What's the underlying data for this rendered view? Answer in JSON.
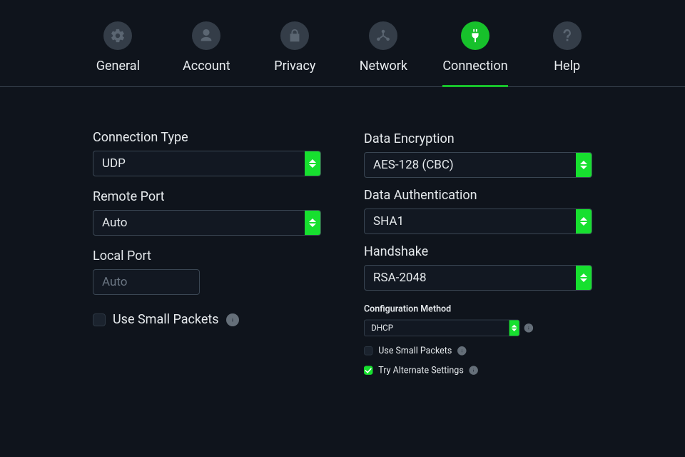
{
  "tabs": {
    "general": {
      "label": "General"
    },
    "account": {
      "label": "Account"
    },
    "privacy": {
      "label": "Privacy"
    },
    "network": {
      "label": "Network"
    },
    "connection": {
      "label": "Connection"
    },
    "help": {
      "label": "Help"
    }
  },
  "left": {
    "connection_type": {
      "label": "Connection Type",
      "value": "UDP"
    },
    "remote_port": {
      "label": "Remote Port",
      "value": "Auto"
    },
    "local_port": {
      "label": "Local Port",
      "placeholder": "Auto"
    },
    "use_small_packets": {
      "label": "Use Small Packets",
      "checked": false
    }
  },
  "right": {
    "data_encryption": {
      "label": "Data Encryption",
      "value": "AES-128 (CBC)"
    },
    "data_authentication": {
      "label": "Data Authentication",
      "value": "SHA1"
    },
    "handshake": {
      "label": "Handshake",
      "value": "RSA-2048"
    },
    "config": {
      "heading": "Configuration Method",
      "value": "DHCP",
      "use_small_packets": {
        "label": "Use Small Packets",
        "checked": false
      },
      "try_alternate_settings": {
        "label": "Try Alternate Settings",
        "checked": true
      }
    }
  }
}
